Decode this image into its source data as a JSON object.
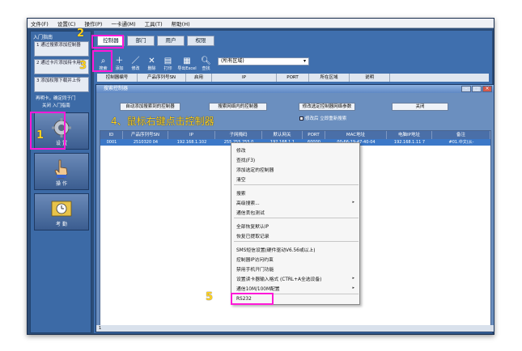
{
  "menubar": [
    "文件(F)",
    "设置(C)",
    "操作(P)",
    "一卡通(M)",
    "工具(T)",
    "帮助(H)"
  ],
  "sidebar": {
    "title": "入门指南",
    "steps": [
      {
        "num": "1",
        "text": "通过搜索添加控制器"
      },
      {
        "num": "2",
        "text": "通过卡片添加持卡用户"
      },
      {
        "num": "3",
        "text": "添加权限下载并上传"
      }
    ],
    "note": "再明卡，确定同于门",
    "link": "关闭 入门指南",
    "buttons": [
      {
        "label": "设 置",
        "icon": "gear-icon"
      },
      {
        "label": "操 作",
        "icon": "hand-icon"
      },
      {
        "label": "考 勤",
        "icon": "clock-icon"
      }
    ]
  },
  "tabs": [
    "控制器",
    "部门",
    "用户",
    "权限"
  ],
  "toolbar": [
    {
      "label": "搜索",
      "icon": "search-icon"
    },
    {
      "label": "添加",
      "icon": "plus-icon"
    },
    {
      "label": "修改",
      "icon": "pencil-icon"
    },
    {
      "label": "删除",
      "icon": "x-icon"
    },
    {
      "label": "打印",
      "icon": "printer-icon"
    },
    {
      "label": "导出Excel",
      "icon": "excel-icon"
    },
    {
      "label": "查找",
      "icon": "magnifier-icon"
    }
  ],
  "area_select": "(所有区域)",
  "col_headers": [
    "控制器编号",
    "产品序列号SN",
    "启用",
    "IP",
    "PORT",
    "所在区域",
    "说明"
  ],
  "dialog": {
    "title": "搜索控制器",
    "buttons": {
      "auto_add": "自动添加搜索到的控制器",
      "search_net": "搜索网络内的控制器",
      "modify_ip": "修改选定控制器网络参数",
      "close": "关闭"
    },
    "check": "修改后 立即重新搜索",
    "grid_headers": [
      "ID",
      "产品序列号SN",
      "IP",
      "子网掩码",
      "默认网关",
      "PORT",
      "MAC地址",
      "电脑IP地址",
      "备注"
    ],
    "row": [
      "0001",
      "2510320 04",
      "192.168.1.102",
      "255.255.255.0",
      "192.168.1.1",
      "60000",
      "00-66-19-47-40-04",
      "192.168.1.11 7",
      "#01.中文(从-"
    ],
    "status": "1"
  },
  "annotations": {
    "n1": "1",
    "n2": "2",
    "n3": "3",
    "n4": "4、鼠标右键点击控制器",
    "n5": "5"
  },
  "context_menu": [
    {
      "label": "修改",
      "arrow": false
    },
    {
      "label": "查找(F3)",
      "arrow": false
    },
    {
      "label": "添加选定的控制器",
      "arrow": false
    },
    {
      "label": "清空",
      "arrow": false
    },
    {
      "label": "搜索",
      "arrow": false
    },
    {
      "label": "高级搜索...",
      "arrow": true
    },
    {
      "label": "通信丢包测试",
      "arrow": false
    },
    {
      "label": "全部恢复默认IP",
      "arrow": false
    },
    {
      "label": "恢复已提取记录",
      "arrow": false
    },
    {
      "label": "SMS短信设置(硬件驱动V6.56或以上)",
      "arrow": false
    },
    {
      "label": "控制器IP访问约束",
      "arrow": false
    },
    {
      "label": "禁用手机开门功能",
      "arrow": false
    },
    {
      "label": "设置读卡器输入格式 (CTRL+A全选设备)",
      "arrow": true
    },
    {
      "label": "通信10M/100M配置",
      "arrow": true
    },
    {
      "label": "RS232",
      "arrow": false
    }
  ]
}
